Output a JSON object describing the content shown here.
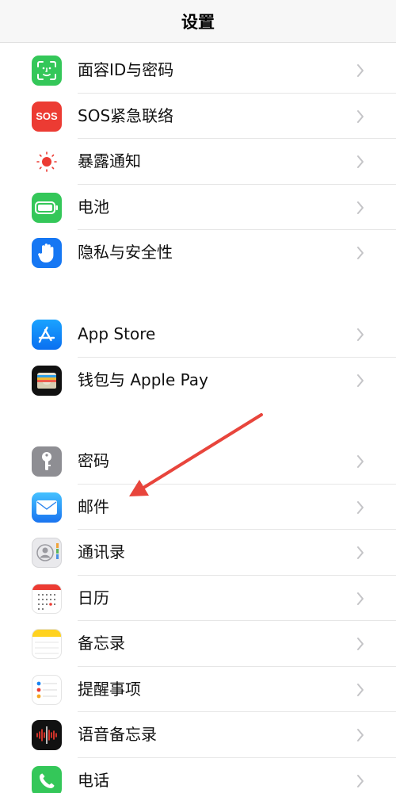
{
  "header": {
    "title": "设置"
  },
  "groups": [
    {
      "items": [
        {
          "label": "面容ID与密码",
          "icon": "face-id-icon"
        },
        {
          "label": "SOS紧急联络",
          "icon": "sos-icon",
          "icon_text": "SOS"
        },
        {
          "label": "暴露通知",
          "icon": "exposure-notification-icon"
        },
        {
          "label": "电池",
          "icon": "battery-icon"
        },
        {
          "label": "隐私与安全性",
          "icon": "privacy-hand-icon"
        }
      ]
    },
    {
      "items": [
        {
          "label": "App Store",
          "icon": "app-store-icon"
        },
        {
          "label": "钱包与 Apple Pay",
          "icon": "wallet-icon"
        }
      ]
    },
    {
      "items": [
        {
          "label": "密码",
          "icon": "key-icon"
        },
        {
          "label": "邮件",
          "icon": "mail-icon"
        },
        {
          "label": "通讯录",
          "icon": "contacts-icon"
        },
        {
          "label": "日历",
          "icon": "calendar-icon"
        },
        {
          "label": "备忘录",
          "icon": "notes-icon"
        },
        {
          "label": "提醒事项",
          "icon": "reminders-icon"
        },
        {
          "label": "语音备忘录",
          "icon": "voice-memos-icon"
        },
        {
          "label": "电话",
          "icon": "phone-icon"
        }
      ]
    }
  ],
  "annotation": {
    "type": "arrow",
    "color": "#e8453c",
    "points_to": "邮件"
  },
  "colors": {
    "accent_green": "#34c759",
    "sos_red": "#ec3b33",
    "chevron": "#c4c4c7",
    "separator": "#e6e6e6"
  }
}
